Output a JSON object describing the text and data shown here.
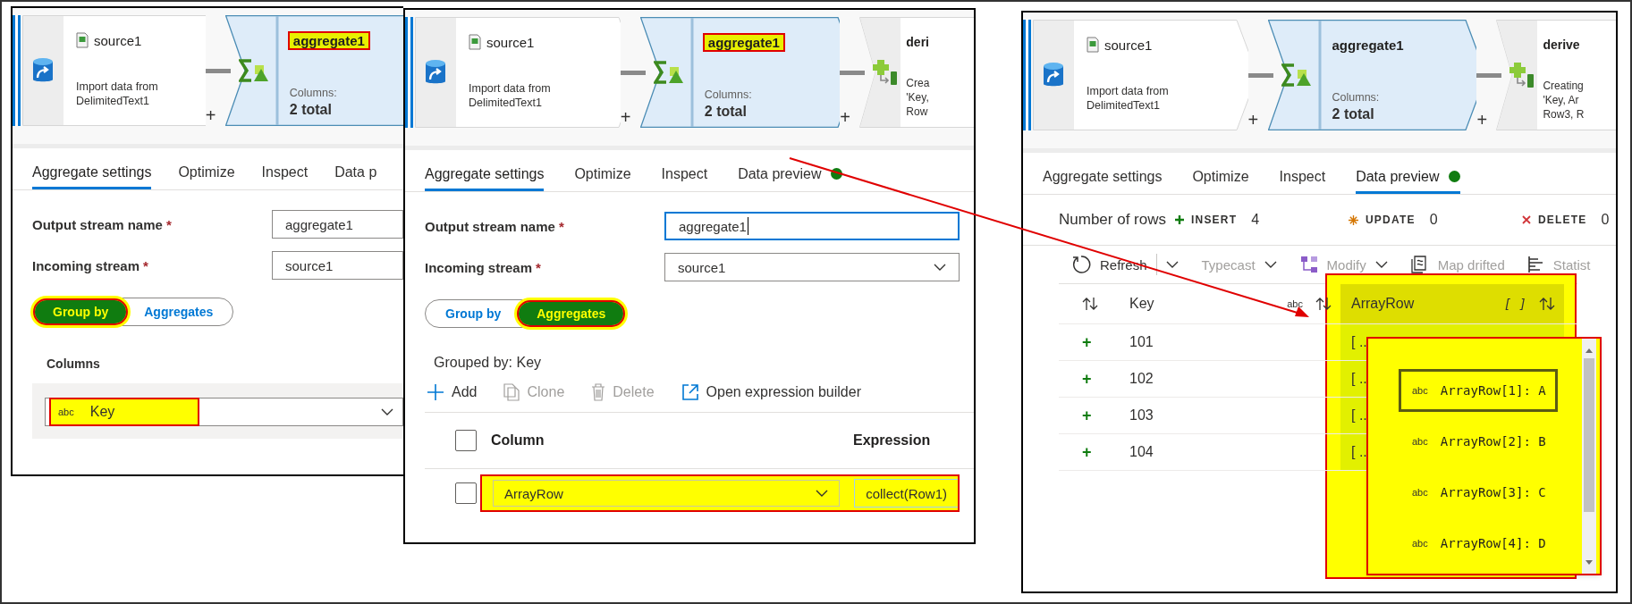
{
  "left_panel": {
    "pipeline": [
      {
        "kind": "source",
        "title": "source1",
        "description": [
          "Import data from",
          "DelimitedText1"
        ],
        "add": "+"
      },
      {
        "kind": "aggregate",
        "title": "aggregate1",
        "highlighted": true,
        "columns_label": "Columns:",
        "columns_value": "2 total"
      }
    ],
    "tabs": [
      {
        "label": "Aggregate settings",
        "selected": true,
        "status_dot": false
      },
      {
        "label": "Optimize",
        "selected": false,
        "status_dot": false
      },
      {
        "label": "Inspect",
        "selected": false,
        "status_dot": false
      },
      {
        "label": "Data p",
        "selected": false,
        "status_dot": false
      }
    ],
    "fields": [
      {
        "label": "Output stream name",
        "required": "*",
        "value": "aggregate1",
        "focused": false
      },
      {
        "label": "Incoming stream",
        "required": "*",
        "value": "source1",
        "focused": false
      }
    ],
    "toggle": [
      {
        "label": "Group by",
        "selected": true,
        "highlighted": true
      },
      {
        "label": "Aggregates",
        "selected": false,
        "highlighted": false
      }
    ],
    "group_by": {
      "label": "Columns",
      "rows": [
        {
          "type": "abc",
          "value": "Key",
          "highlighted": true
        }
      ]
    }
  },
  "middle_panel": {
    "pipeline": [
      {
        "kind": "source",
        "title": "source1",
        "description": [
          "Import data from",
          "DelimitedText1"
        ],
        "add": "+"
      },
      {
        "kind": "aggregate",
        "title": "aggregate1",
        "highlighted": true,
        "columns_label": "Columns:",
        "columns_value": "2 total",
        "add": "+"
      },
      {
        "kind": "derived",
        "title": "deri",
        "description": [
          "Crea",
          "'Key,",
          "Row"
        ]
      }
    ],
    "tabs": [
      {
        "label": "Aggregate settings",
        "selected": true,
        "status_dot": false
      },
      {
        "label": "Optimize",
        "selected": false,
        "status_dot": false
      },
      {
        "label": "Inspect",
        "selected": false,
        "status_dot": false
      },
      {
        "label": "Data preview",
        "selected": false,
        "status_dot": true
      }
    ],
    "fields": [
      {
        "label": "Output stream name",
        "required": "*",
        "value": "aggregate1",
        "kind": "text",
        "focused": true
      },
      {
        "label": "Incoming stream",
        "required": "*",
        "value": "source1",
        "kind": "select",
        "focused": false
      }
    ],
    "toggle": [
      {
        "label": "Group by",
        "selected": false,
        "highlighted": false
      },
      {
        "label": "Aggregates",
        "selected": true,
        "highlighted": true
      }
    ],
    "aggregates": {
      "grouped_by": "Grouped by: Key",
      "toolbar": [
        {
          "kind": "add",
          "label": "Add",
          "disabled": false
        },
        {
          "kind": "clone",
          "label": "Clone",
          "disabled": true
        },
        {
          "kind": "delete",
          "label": "Delete",
          "disabled": true
        },
        {
          "kind": "open",
          "label": "Open expression builder",
          "disabled": false
        }
      ],
      "header_checked": false,
      "columns": [
        "Column",
        "Expression"
      ],
      "rows": [
        {
          "checked": false,
          "column": "ArrayRow",
          "expression": "collect(Row1)",
          "highlighted": true
        }
      ]
    }
  },
  "right_panel": {
    "pipeline": [
      {
        "kind": "source",
        "title": "source1",
        "description": [
          "Import data from",
          "DelimitedText1"
        ],
        "add": "+"
      },
      {
        "kind": "aggregate",
        "title": "aggregate1",
        "highlighted": false,
        "columns_label": "Columns:",
        "columns_value": "2 total",
        "add": "+"
      },
      {
        "kind": "derived",
        "title": "derive",
        "description": [
          "Creating",
          "'Key, Ar",
          "Row3, R"
        ]
      }
    ],
    "tabs": [
      {
        "label": "Aggregate settings",
        "selected": false,
        "status_dot": false
      },
      {
        "label": "Optimize",
        "selected": false,
        "status_dot": false
      },
      {
        "label": "Inspect",
        "selected": false,
        "status_dot": false
      },
      {
        "label": "Data preview",
        "selected": true,
        "status_dot": true
      }
    ],
    "preview": {
      "rows_label": "Number of rows",
      "counts": [
        {
          "kind": "insert",
          "label": "INSERT",
          "value": "4"
        },
        {
          "kind": "update",
          "label": "UPDATE",
          "value": "0"
        },
        {
          "kind": "delete",
          "label": "DELETE",
          "value": "0"
        }
      ],
      "toolbar": [
        {
          "kind": "refresh",
          "label": "Refresh",
          "disabled": false,
          "menu": true
        },
        {
          "kind": "typecast",
          "label": "Typecast",
          "disabled": true,
          "menu": true
        },
        {
          "kind": "modify",
          "label": "Modify",
          "disabled": true,
          "menu": true
        },
        {
          "kind": "map",
          "label": "Map drifted",
          "disabled": true,
          "menu": false
        },
        {
          "kind": "stats",
          "label": "Statist",
          "disabled": true,
          "menu": false
        }
      ],
      "columns": [
        {
          "label": "Key",
          "type": "abc",
          "highlighted": false
        },
        {
          "label": "ArrayRow",
          "type": "[ ]",
          "highlighted": true
        }
      ],
      "rows": [
        {
          "marker": "+",
          "key": "101",
          "value": "[ .."
        },
        {
          "marker": "+",
          "key": "102",
          "value": "[ .."
        },
        {
          "marker": "+",
          "key": "103",
          "value": "[ .."
        },
        {
          "marker": "+",
          "key": "104",
          "value": "[ .."
        }
      ],
      "popup": [
        {
          "type": "abc",
          "label": "ArrayRow[1]: A",
          "selected": true
        },
        {
          "type": "abc",
          "label": "ArrayRow[2]: B",
          "selected": false
        },
        {
          "type": "abc",
          "label": "ArrayRow[3]: C",
          "selected": false
        },
        {
          "type": "abc",
          "label": "ArrayRow[4]: D",
          "selected": false
        }
      ]
    }
  }
}
